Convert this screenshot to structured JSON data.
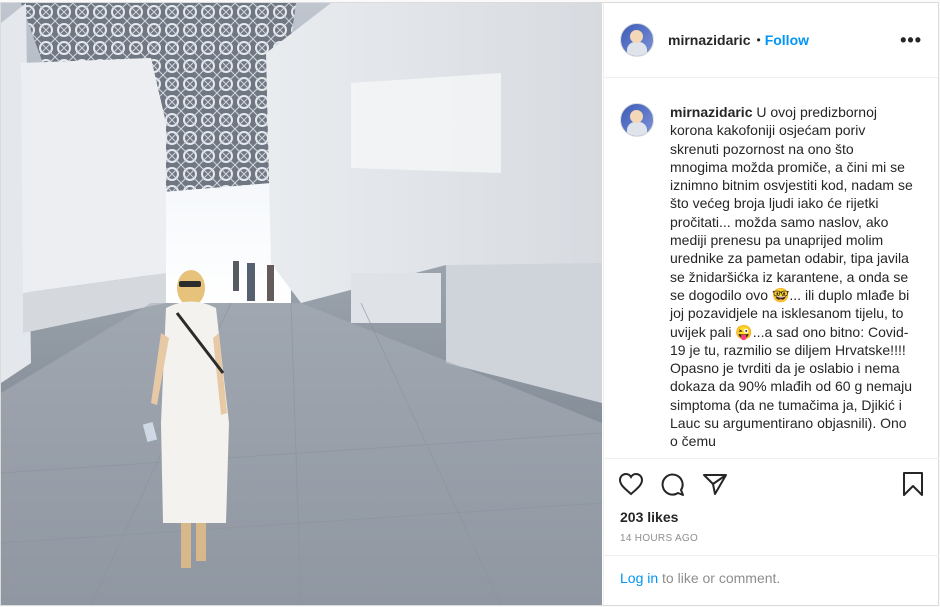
{
  "post": {
    "username": "mirnazidaric",
    "follow_label": "Follow",
    "separator": "•",
    "more_label": "•••"
  },
  "caption": {
    "username": "mirnazidaric",
    "text": " U ovoj predizbornoj korona kakofoniji osjećam poriv skrenuti pozornost na ono što mnogima možda promiče, a čini mi se iznimno bitnim osvjestiti kod, nadam se što većeg broja ljudi iako će rijetki pročitati... možda samo naslov, ako mediji prenesu pa unaprijed molim urednike za pametan odabir, tipa javila se žnidaršićka iz karantene, a onda se se dogodilo ovo 🤓... ili duplo mlađe bi joj pozavidjele na isklesanom tijelu, to uvijek pali 😜...a sad ono bitno: Covid-19 je tu, razmilio se diljem Hrvatske!!!! Opasno je tvrditi da je oslabio i nema dokaza da 90% mlađih od 60 g nemaju simptoma (da ne tumačima ja, Djikić i Lauc su argumentirano objasnili). Ono o čemu"
  },
  "stats": {
    "likes": "203 likes",
    "time": "14 HOURS AGO"
  },
  "footer": {
    "login_link": "Log in",
    "login_text": " to like or comment."
  },
  "icons": [
    "heart-icon",
    "comment-icon",
    "share-icon",
    "bookmark-icon"
  ]
}
